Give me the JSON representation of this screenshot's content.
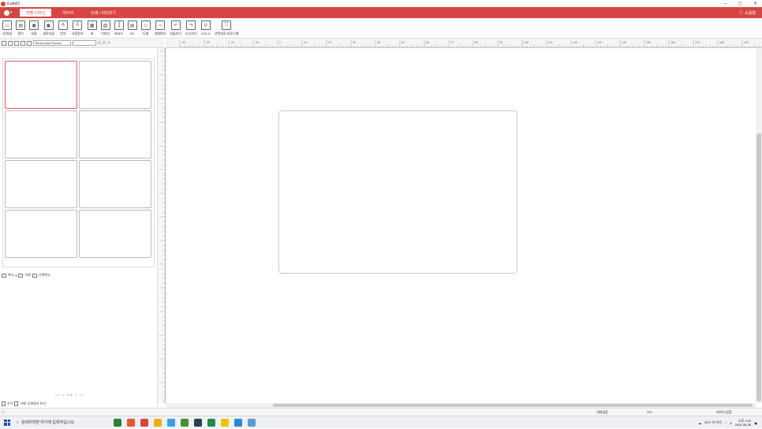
{
  "window": {
    "title": "iLabel2",
    "min": "–",
    "max": "▢",
    "close": "✕"
  },
  "ribbon": {
    "tabs": [
      {
        "label": "라벨 디자인",
        "active": true
      },
      {
        "label": "데이터"
      },
      {
        "label": "인쇄 / 미리보기"
      }
    ],
    "help": "도움말"
  },
  "toolbar": {
    "items": [
      {
        "icon": "new-label-icon",
        "label": "새 파일"
      },
      {
        "icon": "open-icon",
        "label": "열기"
      },
      {
        "icon": "save-icon",
        "label": "저장"
      },
      {
        "icon": "save-as-icon",
        "label": "새로저장"
      },
      {
        "icon": "text-icon",
        "label": "문자"
      },
      {
        "icon": "wordart-icon",
        "label": "사용문자"
      },
      {
        "icon": "table-icon",
        "label": "표"
      },
      {
        "icon": "image-icon",
        "label": "이미지"
      },
      {
        "icon": "barcode-icon",
        "label": "바코드"
      },
      {
        "icon": "field-icon",
        "label": "FA"
      },
      {
        "icon": "shape-icon",
        "label": "도형"
      },
      {
        "icon": "align-icon",
        "label": "개체편리"
      },
      {
        "icon": "undo-icon",
        "label": "되돌리기"
      },
      {
        "icon": "redo-icon",
        "label": "다시하기"
      },
      {
        "icon": "zoom-icon",
        "label": "215 %"
      },
      {
        "icon": "basket-icon",
        "label": "선택자료 바로구매"
      }
    ]
  },
  "format": {
    "font": "Times New Roman",
    "size": ""
  },
  "ruler": {
    "top_ticks": [
      "-40",
      "-30",
      "-20",
      "-10",
      "0",
      "10",
      "20",
      "30",
      "40",
      "50",
      "60",
      "70",
      "80",
      "90",
      "100",
      "110",
      "120",
      "130",
      "140",
      "150",
      "160",
      "170",
      "180",
      "190"
    ]
  },
  "panel": {
    "actions": [
      {
        "icon": "copy-icon",
        "label": "복사"
      },
      {
        "icon": "delete-icon",
        "label": "삭제"
      },
      {
        "icon": "select-copy-icon",
        "label": "선택복사"
      }
    ],
    "pager": "<<  <  1/1  >  >>",
    "bottom": [
      {
        "icon": "add-page-icon",
        "label": "추가"
      },
      {
        "icon": "remove-page-icon",
        "label": "삭제"
      },
      {
        "label": "인쇄용지 보기"
      }
    ]
  },
  "status": {
    "left_label": "개체없음",
    "value": "224",
    "right_label": "데이터 없음"
  },
  "taskbar": {
    "search_placeholder": "검색하려면 여기에 입력하십시오.",
    "weather": "28°C 비 약간",
    "time": "오후 2:20",
    "date": "2022-06-26",
    "lang": "A",
    "apps": [
      "#2f7d32",
      "#e55a2b",
      "#d9443e",
      "#e7b416",
      "#3aa0e6",
      "#4a8f2e",
      "#2c3e50",
      "#1f8a4c",
      "#f2c200",
      "#2b88d8",
      "#5a9bd5"
    ]
  }
}
